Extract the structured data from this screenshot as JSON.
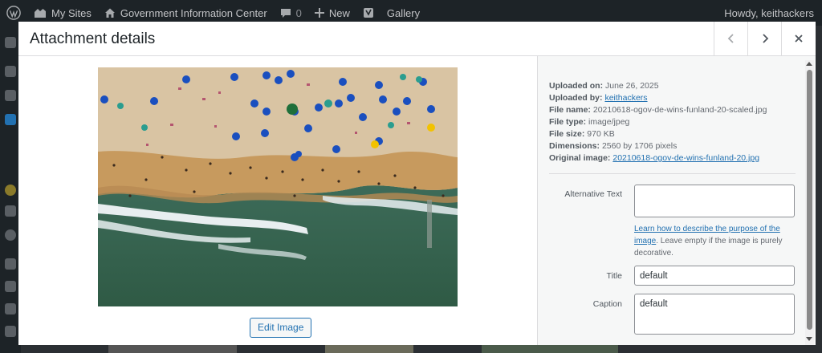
{
  "adminbar": {
    "my_sites": "My Sites",
    "site_name": "Government Information Center",
    "comments_count": "0",
    "new_label": "New",
    "gallery_label": "Gallery",
    "howdy": "Howdy, keithackers"
  },
  "modal": {
    "title": "Attachment details",
    "prev_icon": "chevron-left-icon",
    "next_icon": "chevron-right-icon",
    "close_icon": "close-icon",
    "edit_image_label": "Edit Image"
  },
  "details": {
    "uploaded_on_label": "Uploaded on:",
    "uploaded_on": "June 26, 2025",
    "uploaded_by_label": "Uploaded by:",
    "uploaded_by": "keithackers",
    "file_name_label": "File name:",
    "file_name": "20210618-ogov-de-wins-funland-20-scaled.jpg",
    "file_type_label": "File type:",
    "file_type": "image/jpeg",
    "file_size_label": "File size:",
    "file_size": "970 KB",
    "dimensions_label": "Dimensions:",
    "dimensions": "2560 by 1706 pixels",
    "original_image_label": "Original image:",
    "original_image": "20210618-ogov-de-wins-funland-20.jpg"
  },
  "fields": {
    "alt_text_label": "Alternative Text",
    "alt_text_value": "",
    "help_link": "Learn how to describe the purpose of the image",
    "help_rest": ". Leave empty if the image is purely decorative.",
    "title_label": "Title",
    "title_value": "default",
    "caption_label": "Caption",
    "caption_value": "default"
  },
  "colors": {
    "accent": "#2271b1",
    "admin_bar": "#1d2327"
  }
}
